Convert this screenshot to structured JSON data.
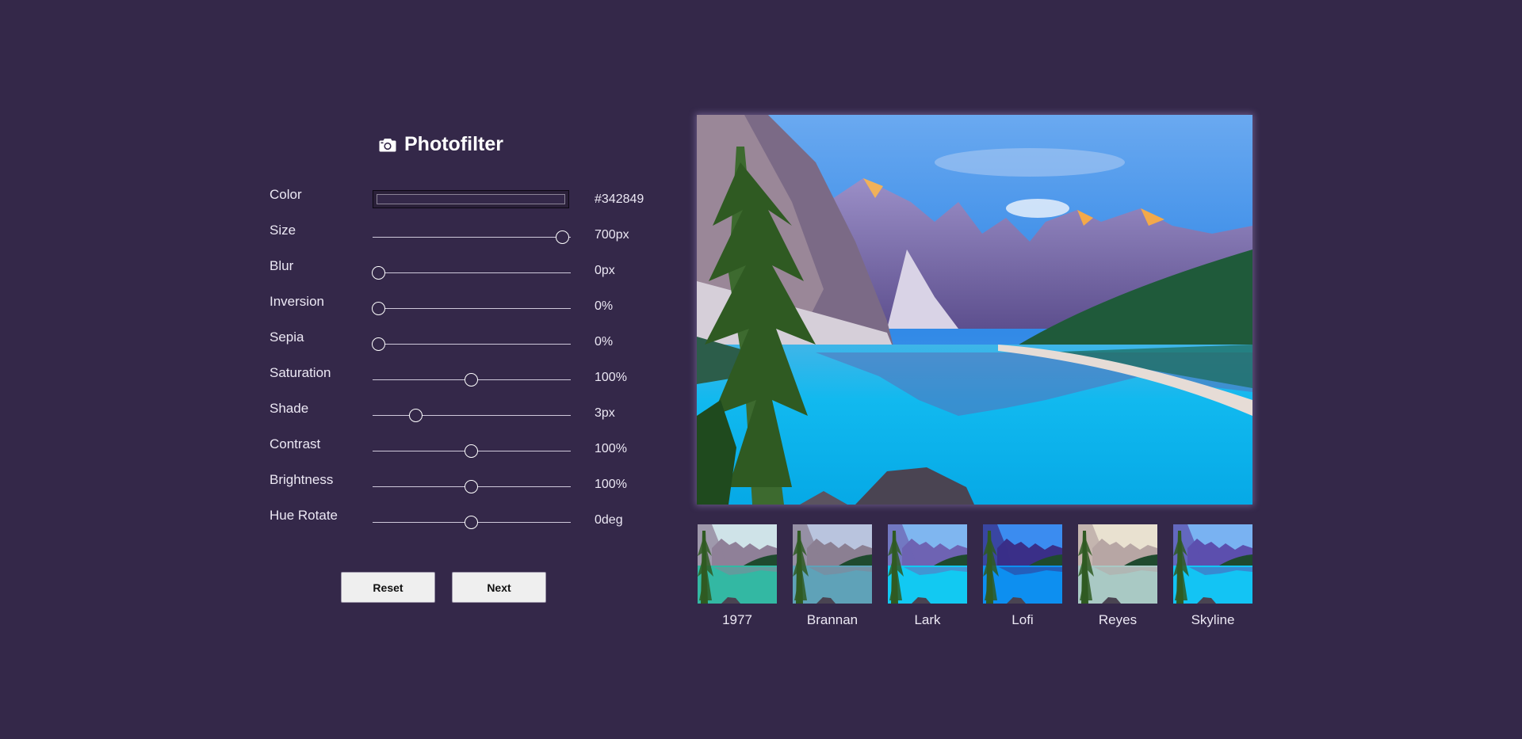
{
  "app": {
    "title": "Photofilter",
    "title_icon": "camera-icon"
  },
  "controls": [
    {
      "id": "color",
      "label": "Color",
      "type": "color",
      "value": "#342849",
      "display": "#342849"
    },
    {
      "id": "size",
      "label": "Size",
      "type": "range",
      "percent": 96,
      "display": "700px"
    },
    {
      "id": "blur",
      "label": "Blur",
      "type": "range",
      "percent": 3,
      "display": "0px"
    },
    {
      "id": "inversion",
      "label": "Inversion",
      "type": "range",
      "percent": 3,
      "display": "0%"
    },
    {
      "id": "sepia",
      "label": "Sepia",
      "type": "range",
      "percent": 3,
      "display": "0%"
    },
    {
      "id": "saturation",
      "label": "Saturation",
      "type": "range",
      "percent": 50,
      "display": "100%"
    },
    {
      "id": "shade",
      "label": "Shade",
      "type": "range",
      "percent": 22,
      "display": "3px"
    },
    {
      "id": "contrast",
      "label": "Contrast",
      "type": "range",
      "percent": 50,
      "display": "100%"
    },
    {
      "id": "brightness",
      "label": "Brightness",
      "type": "range",
      "percent": 50,
      "display": "100%"
    },
    {
      "id": "hue-rotate",
      "label": "Hue Rotate",
      "type": "range",
      "percent": 50,
      "display": "0deg"
    }
  ],
  "buttons": {
    "reset_label": "Reset",
    "next_label": "Next"
  },
  "filters": [
    {
      "id": "1977",
      "label": "1977",
      "sky": "#cfe3e8",
      "water": "#33b8a3",
      "mountain": "#8f8098"
    },
    {
      "id": "brannan",
      "label": "Brannan",
      "sky": "#b9c4de",
      "water": "#5fa2b8",
      "mountain": "#8b7f92"
    },
    {
      "id": "lark",
      "label": "Lark",
      "sky": "#7fb6f0",
      "water": "#12c9f2",
      "mountain": "#6e63b3"
    },
    {
      "id": "lofi",
      "label": "Lofi",
      "sky": "#3b8cf0",
      "water": "#0d8ff0",
      "mountain": "#3a2f88"
    },
    {
      "id": "reyes",
      "label": "Reyes",
      "sky": "#e9e1d0",
      "water": "#a9c9c4",
      "mountain": "#b7a6a4"
    },
    {
      "id": "skyline",
      "label": "Skyline",
      "sky": "#79b2f2",
      "water": "#13c4f4",
      "mountain": "#5c4fae"
    }
  ],
  "colors": {
    "background": "#342849",
    "text": "#ece8f4",
    "button_bg": "#efefef"
  }
}
